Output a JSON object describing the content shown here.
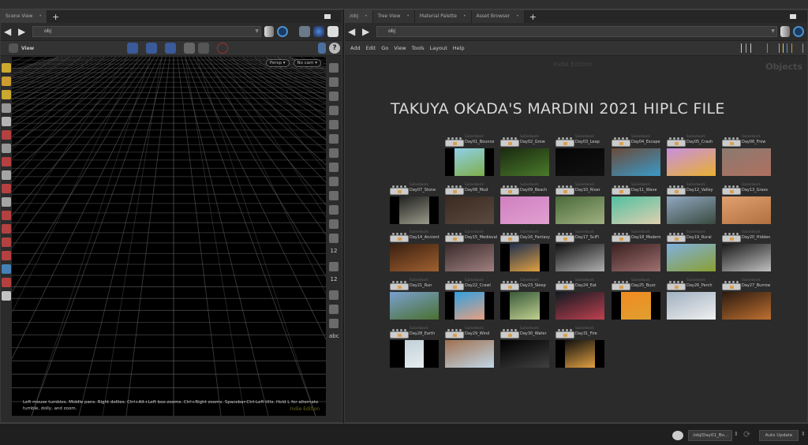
{
  "left_pane": {
    "tabs": [
      {
        "label": "Scene View"
      }
    ],
    "path": "obj",
    "toolbar_label": "View",
    "viewport": {
      "camera_mode": "Persp ▾",
      "camera": "No cam ▾",
      "help_text": "Left mouse tumbles. Middle pans. Right dollies. Ctrl+Alt+Left box-zooms. Ctrl+Right zooms. Spacebar-Ctrl-Left tilts. Hold L for alternate tumble, dolly, and zoom.",
      "watermark": "Indie Edition"
    },
    "right_tools_text": [
      "12",
      "12",
      "abc"
    ]
  },
  "right_pane": {
    "tabs": [
      {
        "label": "/obj"
      },
      {
        "label": "Tree View"
      },
      {
        "label": "Material Palette"
      },
      {
        "label": "Asset Browser"
      }
    ],
    "path": "obj",
    "menu": [
      "Add",
      "Edit",
      "Go",
      "View",
      "Tools",
      "Layout",
      "Help"
    ],
    "watermark": "Indie Edition",
    "context": "Objects",
    "title": "TAKUYA OKADA'S MARDINI 2021 HIPLC FILE",
    "node_type": "Subnetwork",
    "nodes": [
      {
        "name": "Day01_Bounce",
        "c": [
          "#8fd0e8",
          "#7fae4a"
        ],
        "w": 0.6
      },
      {
        "name": "Day02_Grow",
        "c": [
          "#1a2a10",
          "#4a7a2a"
        ],
        "w": 1
      },
      {
        "name": "Day03_Leap",
        "c": [
          "#050505",
          "#111111"
        ],
        "w": 1
      },
      {
        "name": "Day04_Escape",
        "c": [
          "#6a4a3a",
          "#3a9ac8"
        ],
        "w": 1
      },
      {
        "name": "Day05_Crash",
        "c": [
          "#c890e0",
          "#e8b030"
        ],
        "w": 1
      },
      {
        "name": "Day06_Frow",
        "c": [
          "#8a7a70",
          "#b07060"
        ],
        "w": 1
      },
      {
        "name": "Day07_Stone",
        "c": [
          "#222222",
          "#9a9a8a"
        ],
        "w": 0.6
      },
      {
        "name": "Day08_Mud",
        "c": [
          "#3a2a20",
          "#5a4a40"
        ],
        "w": 1
      },
      {
        "name": "Day09_Beach",
        "c": [
          "#d080c0",
          "#e0a0d0"
        ],
        "w": 1
      },
      {
        "name": "Day10_River",
        "c": [
          "#4a6a3a",
          "#a0b080"
        ],
        "w": 1
      },
      {
        "name": "Day11_Wave",
        "c": [
          "#50c0a0",
          "#e0d0b0"
        ],
        "w": 1
      },
      {
        "name": "Day12_Valley",
        "c": [
          "#90a8c0",
          "#3a4a40"
        ],
        "w": 1
      },
      {
        "name": "Day13_Grass",
        "c": [
          "#e0a070",
          "#b07040"
        ],
        "w": 1
      },
      {
        "name": "Day14_Ancient",
        "c": [
          "#3a2010",
          "#a06030"
        ],
        "w": 1
      },
      {
        "name": "Day15_Medieval",
        "c": [
          "#3a2a2a",
          "#a08080"
        ],
        "w": 1
      },
      {
        "name": "Day16_Fantasy",
        "c": [
          "#203050",
          "#e0a040"
        ],
        "w": 0.6
      },
      {
        "name": "Day17_SciFi",
        "c": [
          "#111111",
          "#b0b0b0"
        ],
        "w": 1
      },
      {
        "name": "Day18_Modern",
        "c": [
          "#3a2020",
          "#a07070"
        ],
        "w": 1
      },
      {
        "name": "Day19_Rural",
        "c": [
          "#80b0e0",
          "#8aa030"
        ],
        "w": 1
      },
      {
        "name": "Day20_Hidden",
        "c": [
          "#1a1a1a",
          "#c0c0c0"
        ],
        "w": 1
      },
      {
        "name": "Day21_Run",
        "c": [
          "#7aa0d0",
          "#4a7030"
        ],
        "w": 1
      },
      {
        "name": "Day22_Crawl",
        "c": [
          "#30a0e0",
          "#e8a080"
        ],
        "w": 0.6
      },
      {
        "name": "Day23_Sleep",
        "c": [
          "#3a5a3a",
          "#c0d090"
        ],
        "w": 0.6
      },
      {
        "name": "Day24_Eat",
        "c": [
          "#101a20",
          "#c04050"
        ],
        "w": 1
      },
      {
        "name": "Day25_Buzz",
        "c": [
          "#f08a20",
          "#e0a030"
        ],
        "w": 0.6
      },
      {
        "name": "Day26_Perch",
        "c": [
          "#a0b0c0",
          "#f0f0f0"
        ],
        "w": 1
      },
      {
        "name": "Day27_Burrow",
        "c": [
          "#2a1a10",
          "#c07030"
        ],
        "w": 1
      },
      {
        "name": "Day28_Earth",
        "c": [
          "#c0d0d8",
          "#e8eef0"
        ],
        "w": 0.4
      },
      {
        "name": "Day29_Wind",
        "c": [
          "#a07050",
          "#c0d8e8"
        ],
        "w": 1
      },
      {
        "name": "Day30_Water",
        "c": [
          "#000000",
          "#404040"
        ],
        "w": 1
      },
      {
        "name": "Day31_Fire",
        "c": [
          "#101010",
          "#e0a040"
        ],
        "w": 0.6
      }
    ]
  },
  "status_bar": {
    "path": "/obj/Day01_Bo...",
    "update_mode": "Auto Update"
  },
  "colors": {
    "bg": "#2b2b2b",
    "viewport": "#000000",
    "grid": "#5a5a5a"
  }
}
